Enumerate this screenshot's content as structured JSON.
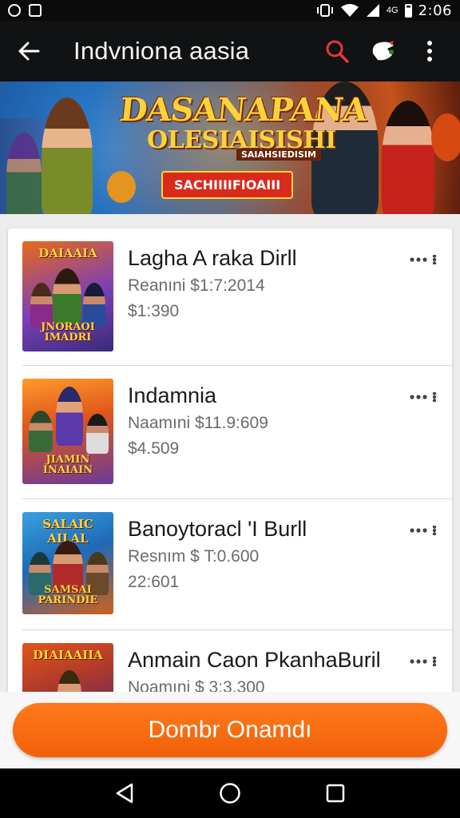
{
  "status_bar": {
    "time": "2:06",
    "left_icons": [
      "whatsapp-icon",
      "notification-icon"
    ],
    "right_icons": [
      "vibrate-icon",
      "wifi-icon",
      "signal-icon",
      "battery-icon"
    ],
    "extra_glyph": "4G"
  },
  "app_bar": {
    "title": "Indvniona aasia",
    "icons": [
      "back-arrow-icon",
      "search-icon",
      "app-logo-icon",
      "more-vert-icon"
    ],
    "accent": "#e53935"
  },
  "banner": {
    "title": "DASANAPANA",
    "subtitle": "OLESIAISISHI",
    "strip": "SAIAHSIEDISIM",
    "button": "SACHIIIIFIOAIII"
  },
  "items": [
    {
      "title": "Lagha A raka Dirll",
      "line1": "Reanıni $1:7:2014",
      "line2": "$1:390",
      "thumb_title": "DAIAAIA",
      "thumb_sub": "JNORAOI IMADRI"
    },
    {
      "title": "Indamnia",
      "line1": "Naamıni $11.9:609",
      "line2": "$4.509",
      "thumb_title": "",
      "thumb_sub": "JIAMIN INAIAIN"
    },
    {
      "title": "Banoytoracl 'I Burll",
      "line1": "Resnım $ T:0.600",
      "line2": "22:601",
      "thumb_title": "SALAIC AILAL",
      "thumb_sub": "SAMSAI PARINDIE"
    },
    {
      "title": "Anmain Caon PkanhaBuril",
      "line1": "Noamıni $ 3:3.300",
      "line2": "",
      "thumb_title": "DIAIAAIIA",
      "thumb_sub": ""
    }
  ],
  "cta": {
    "label": "Dombr Onamdı",
    "color": "#f26a10"
  },
  "nav_bar": {
    "icons": [
      "back-triangle-icon",
      "home-circle-icon",
      "recents-square-icon"
    ]
  }
}
